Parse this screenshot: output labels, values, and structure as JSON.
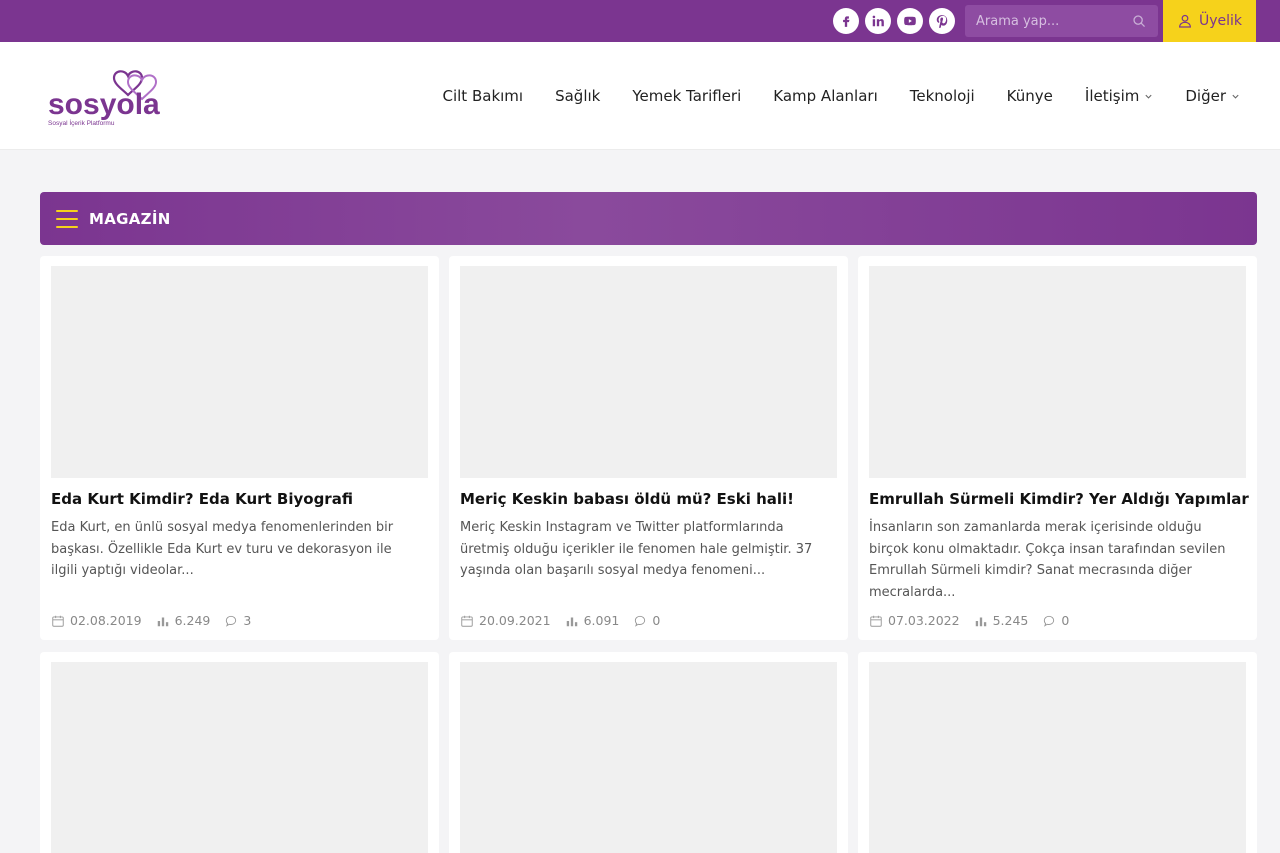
{
  "topbar": {
    "social": [
      {
        "icon": "facebook-icon",
        "label": "f"
      },
      {
        "icon": "linkedin-icon",
        "label": "in"
      },
      {
        "icon": "youtube-icon",
        "label": "▶"
      },
      {
        "icon": "pinterest-icon",
        "label": "p"
      }
    ],
    "search_placeholder": "Arama yap...",
    "member_label": "Üyelik"
  },
  "header": {
    "logo_text": "sosyola",
    "logo_tagline": "Sosyal İçerik Platformu",
    "nav": [
      {
        "label": "Cilt Bakımı"
      },
      {
        "label": "Sağlık"
      },
      {
        "label": "Yemek Tarifleri"
      },
      {
        "label": "Kamp Alanları"
      },
      {
        "label": "Teknoloji"
      },
      {
        "label": "Künye"
      },
      {
        "label": "İletişim",
        "dropdown": true
      },
      {
        "label": "Diğer",
        "dropdown": true
      }
    ]
  },
  "section": {
    "title": "MAGAZİN"
  },
  "cards": [
    {
      "title": "Eda Kurt Kimdir? Eda Kurt Biyografi",
      "excerpt": "Eda Kurt, en ünlü sosyal medya fenomenlerinden bir başkası. Özellikle Eda Kurt ev turu ve dekorasyon ile ilgili yaptığı videolar...",
      "date": "02.08.2019",
      "views": "6.249",
      "comments": "3"
    },
    {
      "title": "Meriç Keskin babası öldü mü? Eski hali!",
      "excerpt": "Meriç Keskin  Instagram ve Twitter platformlarında üretmiş olduğu içerikler ile fenomen hale gelmiştir. 37 yaşında olan başarılı sosyal medya fenomeni...",
      "date": "20.09.2021",
      "views": "6.091",
      "comments": "0"
    },
    {
      "title": "Emrullah Sürmeli Kimdir? Yer Aldığı Yapımlar",
      "excerpt": "İnsanların son zamanlarda merak içerisinde olduğu birçok konu olmaktadır. Çokça insan tarafından sevilen Emrullah Sürmeli kimdir? Sanat mecrasında diğer mecralarda...",
      "date": "07.03.2022",
      "views": "5.245",
      "comments": "0"
    }
  ],
  "colors": {
    "brand_purple": "#7b3590",
    "accent_yellow": "#f6d21b"
  }
}
